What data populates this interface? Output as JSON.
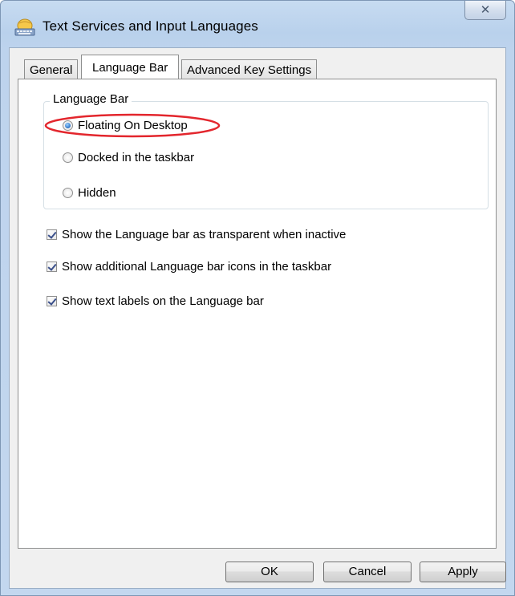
{
  "window": {
    "title": "Text Services and Input Languages",
    "close_label": "✕"
  },
  "tabs": [
    {
      "label": "General",
      "active": false
    },
    {
      "label": "Language Bar",
      "active": true
    },
    {
      "label": "Advanced Key Settings",
      "active": false
    }
  ],
  "language_bar_group": {
    "legend": "Language Bar",
    "options": [
      {
        "label": "Floating On Desktop",
        "checked": true
      },
      {
        "label": "Docked in the taskbar",
        "checked": false
      },
      {
        "label": "Hidden",
        "checked": false
      }
    ]
  },
  "checkboxes": [
    {
      "label": "Show the Language bar as transparent when inactive",
      "checked": true
    },
    {
      "label": "Show additional Language bar icons in the taskbar",
      "checked": true
    },
    {
      "label": "Show text labels on the Language bar",
      "checked": true
    }
  ],
  "buttons": {
    "ok": "OK",
    "cancel": "Cancel",
    "apply": "Apply"
  },
  "colors": {
    "highlight_ellipse": "#e3262d",
    "title_bar": "#c3d7ef"
  }
}
